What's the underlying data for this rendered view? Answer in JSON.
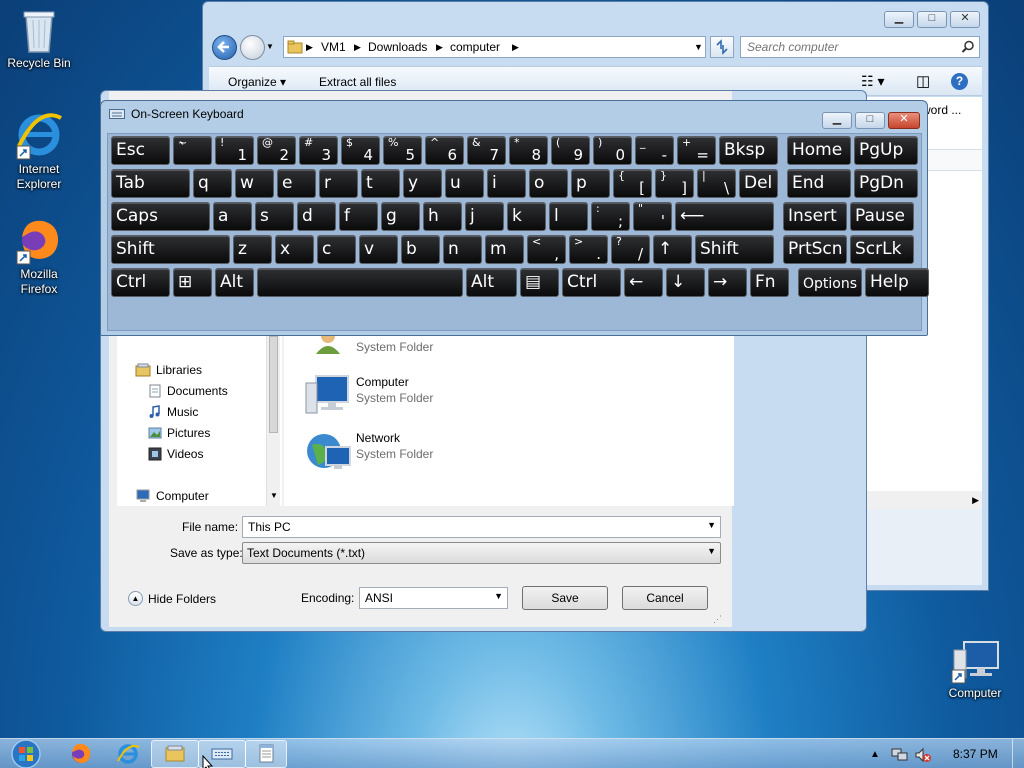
{
  "desktop": {
    "icons": [
      {
        "label": "Recycle Bin",
        "icon": "recycle-bin-icon"
      },
      {
        "label": "Internet Explorer",
        "icon": "internet-explorer-icon"
      },
      {
        "label": "Mozilla Firefox",
        "icon": "firefox-icon"
      },
      {
        "label": "Computer",
        "icon": "computer-icon"
      }
    ]
  },
  "explorer": {
    "breadcrumb": [
      "VM1",
      "Downloads",
      "computer"
    ],
    "search_placeholder": "Search computer",
    "commands": {
      "organize": "Organize",
      "extract": "Extract all files"
    },
    "partial_text": "word ..."
  },
  "osk": {
    "title": "On-Screen Keyboard",
    "rows": [
      [
        {
          "main": "Esc"
        },
        {
          "top": "~",
          "main": "`"
        },
        {
          "top": "!",
          "bot": "1"
        },
        {
          "top": "@",
          "bot": "2"
        },
        {
          "top": "#",
          "bot": "3"
        },
        {
          "top": "$",
          "bot": "4"
        },
        {
          "top": "%",
          "bot": "5"
        },
        {
          "top": "^",
          "bot": "6"
        },
        {
          "top": "&",
          "bot": "7"
        },
        {
          "top": "*",
          "bot": "8"
        },
        {
          "top": "(",
          "bot": "9"
        },
        {
          "top": ")",
          "bot": "0"
        },
        {
          "top": "_",
          "bot": "-"
        },
        {
          "top": "+",
          "bot": "="
        },
        {
          "main": "Bksp"
        },
        {
          "main": "Home"
        },
        {
          "main": "PgUp"
        }
      ],
      [
        {
          "main": "Tab"
        },
        {
          "main": "q"
        },
        {
          "main": "w"
        },
        {
          "main": "e"
        },
        {
          "main": "r"
        },
        {
          "main": "t"
        },
        {
          "main": "y"
        },
        {
          "main": "u"
        },
        {
          "main": "i"
        },
        {
          "main": "o"
        },
        {
          "main": "p"
        },
        {
          "top": "{",
          "bot": "["
        },
        {
          "top": "}",
          "bot": "]"
        },
        {
          "top": "|",
          "bot": "\\"
        },
        {
          "main": "Del"
        },
        {
          "main": "End"
        },
        {
          "main": "PgDn"
        }
      ],
      [
        {
          "main": "Caps"
        },
        {
          "main": "a"
        },
        {
          "main": "s"
        },
        {
          "main": "d"
        },
        {
          "main": "f"
        },
        {
          "main": "g"
        },
        {
          "main": "h"
        },
        {
          "main": "j"
        },
        {
          "main": "k"
        },
        {
          "main": "l"
        },
        {
          "top": ":",
          "bot": ";"
        },
        {
          "top": "\"",
          "bot": "'"
        },
        {
          "main": "⟵"
        },
        {
          "main": "Insert"
        },
        {
          "main": "Pause"
        }
      ],
      [
        {
          "main": "Shift"
        },
        {
          "main": "z"
        },
        {
          "main": "x"
        },
        {
          "main": "c"
        },
        {
          "main": "v"
        },
        {
          "main": "b"
        },
        {
          "main": "n"
        },
        {
          "main": "m"
        },
        {
          "top": "<",
          "bot": ","
        },
        {
          "top": ">",
          "bot": "."
        },
        {
          "top": "?",
          "bot": "/"
        },
        {
          "main": "↑"
        },
        {
          "main": "Shift"
        },
        {
          "main": "PrtScn"
        },
        {
          "main": "ScrLk"
        }
      ],
      [
        {
          "main": "Ctrl"
        },
        {
          "main": "⊞"
        },
        {
          "main": "Alt"
        },
        {
          "main": ""
        },
        {
          "main": "Alt"
        },
        {
          "main": "▤"
        },
        {
          "main": "Ctrl"
        },
        {
          "main": "←"
        },
        {
          "main": "↓"
        },
        {
          "main": "→"
        },
        {
          "main": "Fn"
        },
        {
          "main": "Options"
        },
        {
          "main": "Help"
        }
      ]
    ]
  },
  "dialog": {
    "nav": {
      "libraries": "Libraries",
      "documents": "Documents",
      "music": "Music",
      "pictures": "Pictures",
      "videos": "Videos",
      "computer": "Computer"
    },
    "entries": [
      {
        "name": "",
        "type": "System Folder"
      },
      {
        "name": "Computer",
        "type": "System Folder"
      },
      {
        "name": "Network",
        "type": "System Folder"
      }
    ],
    "file_name_label": "File name:",
    "file_name_value": "This PC",
    "save_type_label": "Save as type:",
    "save_type_value": "Text Documents (*.txt)",
    "hide_folders": "Hide Folders",
    "encoding_label": "Encoding:",
    "encoding_value": "ANSI",
    "save_button": "Save",
    "cancel_button": "Cancel"
  },
  "taskbar": {
    "clock": "8:37 PM",
    "buttons": [
      "start-orb",
      "firefox-icon",
      "internet-explorer-icon",
      "file-explorer-icon",
      "keyboard-icon",
      "notepad-icon"
    ]
  }
}
